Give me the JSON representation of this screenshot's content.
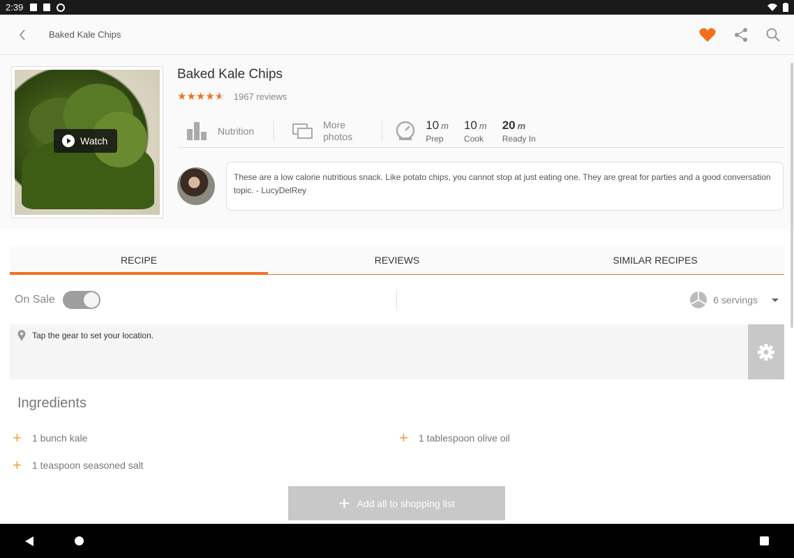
{
  "status_bar": {
    "time": "2:39"
  },
  "app_bar": {
    "title": "Baked Kale Chips"
  },
  "recipe": {
    "title": "Baked Kale Chips",
    "reviews": "1967 reviews",
    "rating": 4.5,
    "watch_label": "Watch",
    "nutrition_label": "Nutrition",
    "more_photos_line1": "More",
    "more_photos_line2": "photos",
    "prep_value": "10",
    "prep_unit": "m",
    "prep_label": "Prep",
    "cook_value": "10",
    "cook_unit": "m",
    "cook_label": "Cook",
    "ready_value": "20",
    "ready_unit": "m",
    "ready_label": "Ready In",
    "description": "These are a low calorie nutritious snack. Like potato chips, you cannot stop at just eating one. They are great for parties and a good conversation topic. - LucyDelRey"
  },
  "tabs": [
    {
      "label": "RECIPE",
      "active": true
    },
    {
      "label": "REVIEWS",
      "active": false
    },
    {
      "label": "SIMILAR RECIPES",
      "active": false
    }
  ],
  "sale": {
    "label": "On Sale",
    "servings": "6 servings"
  },
  "location": {
    "text": "Tap the gear to set your location."
  },
  "ingredients": {
    "title": "Ingredients",
    "items": [
      "1 bunch kale",
      "1 tablespoon olive oil",
      "1 teaspoon seasoned salt"
    ]
  },
  "add_all_label": "Add all to shopping list",
  "colors": {
    "accent": "#f07020",
    "plus": "#f0a040"
  }
}
